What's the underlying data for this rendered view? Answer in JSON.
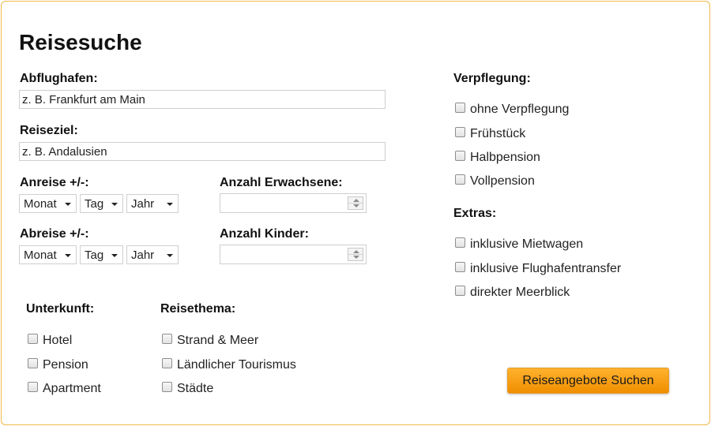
{
  "form": {
    "title": "Reisesuche",
    "departure": {
      "label": "Abflughafen:",
      "value": "z. B. Frankfurt am Main"
    },
    "destination": {
      "label": "Reiseziel:",
      "value": "z. B. Andalusien"
    },
    "arrival": {
      "label": "Anreise +/-:",
      "month": "Monat",
      "day": "Tag",
      "year": "Jahr"
    },
    "return": {
      "label": "Abreise +/-:",
      "month": "Monat",
      "day": "Tag",
      "year": "Jahr"
    },
    "adults": {
      "label": "Anzahl Erwachsene:",
      "value": ""
    },
    "children": {
      "label": "Anzahl Kinder:",
      "value": ""
    },
    "accommodation": {
      "label": "Unterkunft:",
      "options": [
        "Hotel",
        "Pension",
        "Apartment"
      ]
    },
    "theme": {
      "label": "Reisethema:",
      "options": [
        "Strand & Meer",
        "Ländlicher Tourismus",
        "Städte"
      ]
    },
    "catering": {
      "label": "Verpflegung:",
      "options": [
        "ohne Verpflegung",
        "Frühstück",
        "Halbpension",
        "Vollpension"
      ]
    },
    "extras": {
      "label": "Extras:",
      "options": [
        "inklusive Mietwagen",
        "inklusive Flughafentransfer",
        "direkter Meerblick"
      ]
    },
    "submit_label": "Reiseangebote Suchen"
  },
  "colors": {
    "border": "#f0b84a",
    "button_top": "#ffb22e",
    "button_bottom": "#f08e00"
  }
}
